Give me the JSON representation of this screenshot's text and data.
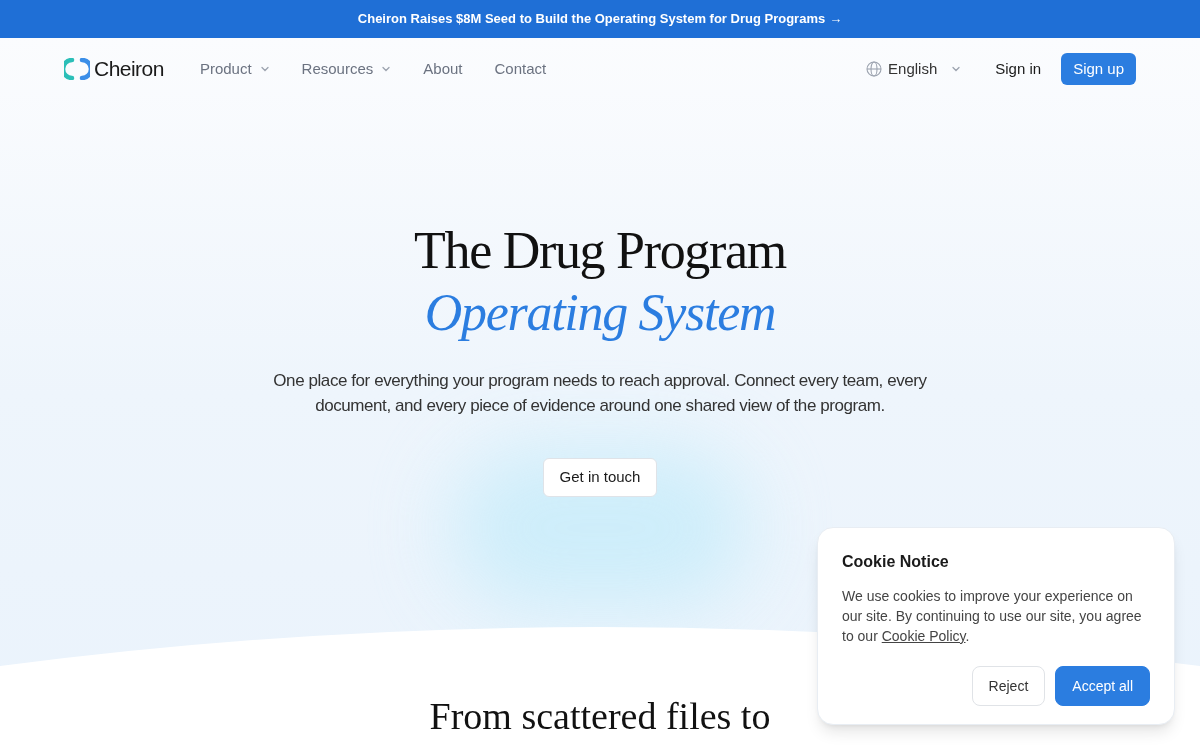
{
  "announcement": {
    "text": "Cheiron Raises $8M Seed to Build the Operating System for Drug Programs",
    "arrow": "→"
  },
  "nav": {
    "brand": "Cheiron",
    "items": [
      {
        "label": "Product",
        "has_menu": true
      },
      {
        "label": "Resources",
        "has_menu": true
      },
      {
        "label": "About",
        "has_menu": false
      },
      {
        "label": "Contact",
        "has_menu": false
      }
    ],
    "language": "English",
    "sign_in": "Sign in",
    "sign_up": "Sign up"
  },
  "hero": {
    "title": "The Drug Program",
    "title_accent": "Operating System",
    "subtitle": "One place for everything your program needs to reach approval. Connect every team, every document, and every piece of evidence around one shared view of the program.",
    "cta": "Get in touch"
  },
  "section": {
    "heading": "From scattered files to"
  },
  "cookie_notice": {
    "title": "Cookie Notice",
    "text_before": "We use cookies to improve your experience on our site. By continuing to use our site, you agree to our ",
    "link": "Cookie Policy",
    "text_after": ".",
    "buttons": [
      {
        "label": "Reject",
        "kind": "secondary"
      },
      {
        "label": "Accept all",
        "kind": "primary"
      }
    ]
  }
}
